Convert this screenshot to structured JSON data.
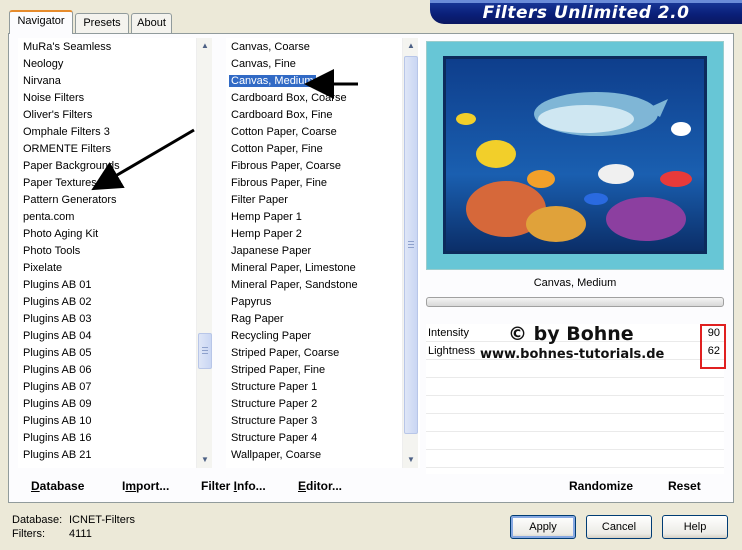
{
  "banner": {
    "title": "Filters Unlimited 2.0"
  },
  "tabs": [
    {
      "label": "Navigator",
      "active": true
    },
    {
      "label": "Presets",
      "active": false
    },
    {
      "label": "About",
      "active": false
    }
  ],
  "categories": {
    "items": [
      "MuRa's Seamless",
      "Neology",
      "Nirvana",
      "Noise Filters",
      "Oliver's Filters",
      "Omphale Filters 3",
      "ORMENTE Filters",
      "Paper Backgrounds",
      "Paper Textures",
      "Pattern Generators",
      "penta.com",
      "Photo Aging Kit",
      "Photo Tools",
      "Pixelate",
      "Plugins AB 01",
      "Plugins AB 02",
      "Plugins AB 03",
      "Plugins AB 04",
      "Plugins AB 05",
      "Plugins AB 06",
      "Plugins AB 07",
      "Plugins AB 09",
      "Plugins AB 10",
      "Plugins AB 16",
      "Plugins AB 21"
    ]
  },
  "filters": {
    "items": [
      "Canvas, Coarse",
      "Canvas, Fine",
      "Canvas, Medium",
      "Cardboard Box, Coarse",
      "Cardboard Box, Fine",
      "Cotton Paper, Coarse",
      "Cotton Paper, Fine",
      "Fibrous Paper, Coarse",
      "Fibrous Paper, Fine",
      "Filter Paper",
      "Hemp Paper 1",
      "Hemp Paper 2",
      "Japanese Paper",
      "Mineral Paper, Limestone",
      "Mineral Paper, Sandstone",
      "Papyrus",
      "Rag Paper",
      "Recycling Paper",
      "Striped Paper, Coarse",
      "Striped Paper, Fine",
      "Structure Paper 1",
      "Structure Paper 2",
      "Structure Paper 3",
      "Structure Paper 4",
      "Wallpaper, Coarse"
    ],
    "selected": "Canvas, Medium"
  },
  "preview": {
    "caption": "Canvas, Medium"
  },
  "params": [
    {
      "label": "Intensity",
      "value": "90"
    },
    {
      "label": "Lightness",
      "value": "62"
    }
  ],
  "watermark": {
    "line1": "© by Bohne",
    "line2": "www.bohnes-tutorials.de"
  },
  "toolbar": {
    "database": {
      "u": "D",
      "rest": "atabase"
    },
    "import": {
      "pre": "I",
      "u": "m",
      "rest": "port..."
    },
    "filter_info": {
      "pre": "Filter ",
      "u": "I",
      "rest": "nfo..."
    },
    "editor": {
      "u": "E",
      "rest": "ditor..."
    },
    "randomize": "Randomize",
    "reset": "Reset"
  },
  "footer": {
    "database_label": "Database:",
    "database_value": "ICNET-Filters",
    "filters_label": "Filters:",
    "filters_value": "4111",
    "apply": "Apply",
    "cancel": "Cancel",
    "help": "Help"
  },
  "colors": {
    "selection": "#316ac5",
    "banner": "#0a1f78",
    "highlight_box": "#e02020"
  }
}
